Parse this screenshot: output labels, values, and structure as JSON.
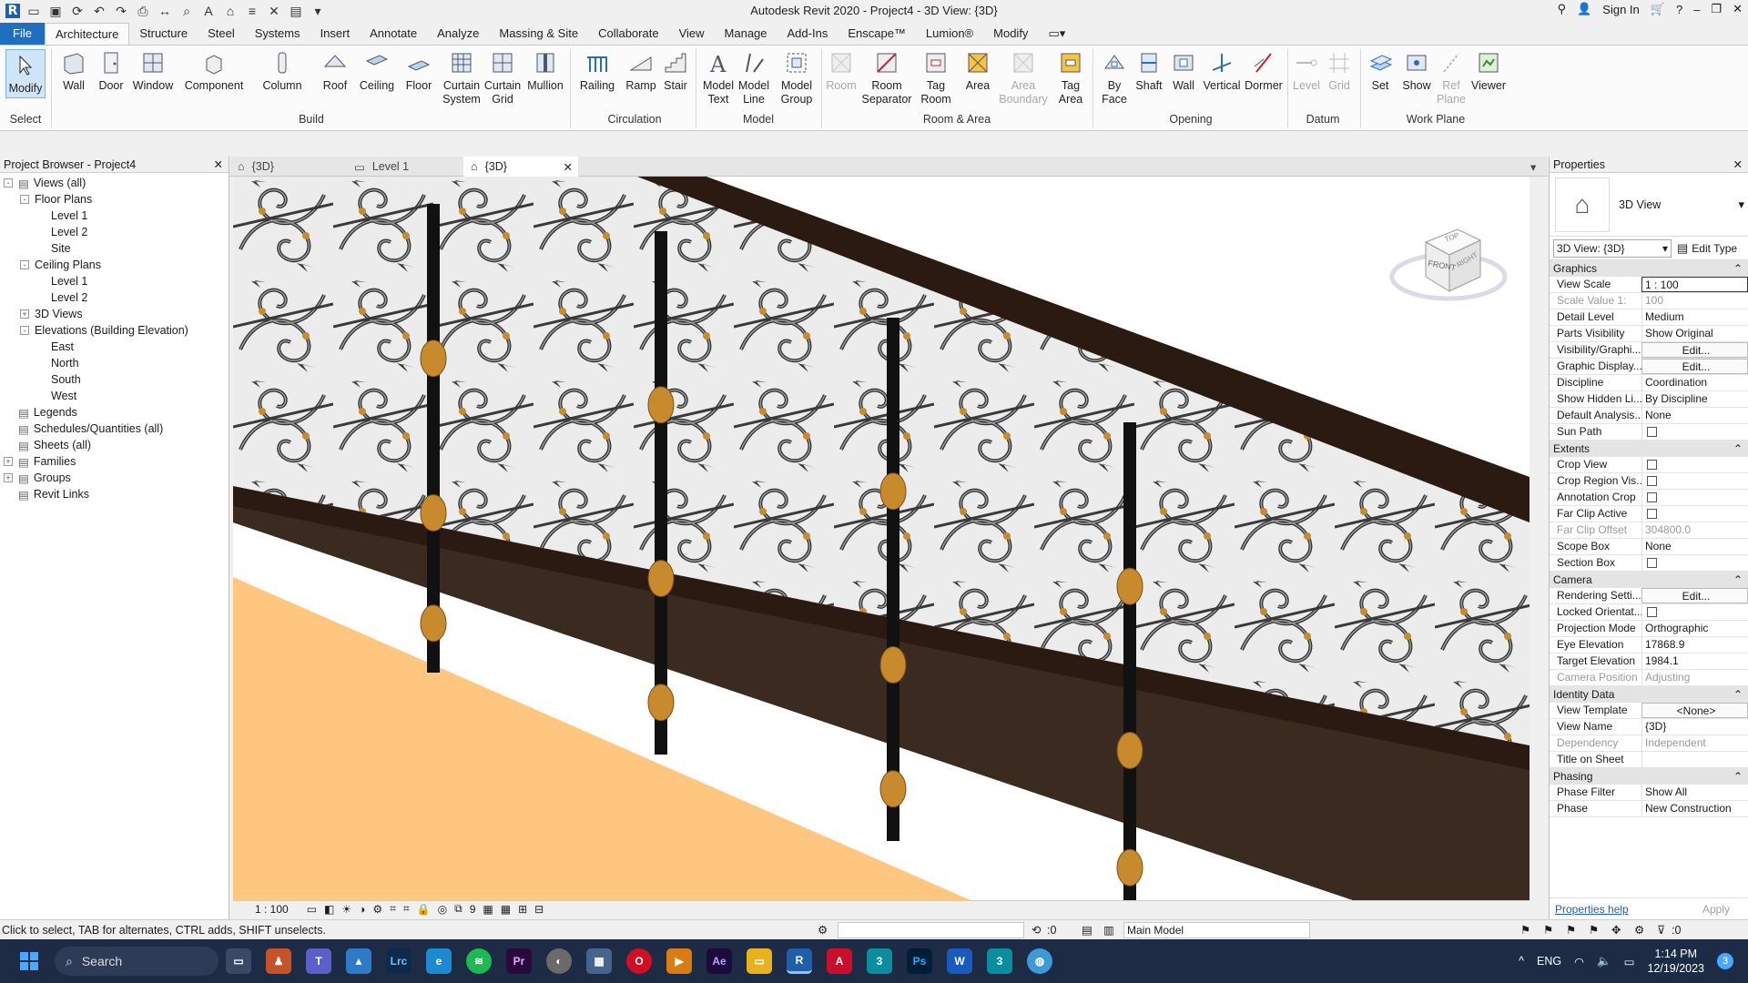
{
  "titlebar": {
    "title": "Autodesk Revit 2020 - Project4 - 3D View: {3D}",
    "sign_in": "Sign In"
  },
  "ribbon_tabs": [
    "File",
    "Architecture",
    "Structure",
    "Steel",
    "Systems",
    "Insert",
    "Annotate",
    "Analyze",
    "Massing & Site",
    "Collaborate",
    "View",
    "Manage",
    "Add-Ins",
    "Enscape™",
    "Lumion®",
    "Modify"
  ],
  "ribbon": {
    "select_label": "Select",
    "modify": "Modify",
    "build": {
      "label": "Build",
      "tools": [
        "Wall",
        "Door",
        "Window",
        "Component",
        "Column",
        "Roof",
        "Ceiling",
        "Floor",
        "Curtain System",
        "Curtain Grid",
        "Mullion"
      ]
    },
    "circulation": {
      "label": "Circulation",
      "tools": [
        "Railing",
        "Ramp",
        "Stair"
      ]
    },
    "model": {
      "label": "Model",
      "tools": [
        "Model Text",
        "Model Line",
        "Model Group"
      ]
    },
    "room_area": {
      "label": "Room & Area",
      "tools": [
        "Room",
        "Room Separator",
        "Tag Room",
        "Area",
        "Area Boundary",
        "Tag Area"
      ]
    },
    "opening": {
      "label": "Opening",
      "tools": [
        "By Face",
        "Shaft",
        "Wall",
        "Vertical",
        "Dormer"
      ]
    },
    "datum": {
      "label": "Datum",
      "tools": [
        "Level",
        "Grid"
      ]
    },
    "work_plane": {
      "label": "Work Plane",
      "tools": [
        "Set",
        "Show",
        "Ref Plane",
        "Viewer"
      ]
    }
  },
  "browser": {
    "title": "Project Browser - Project4",
    "tree": [
      {
        "label": "Views (all)",
        "level": 0,
        "toggle": "-"
      },
      {
        "label": "Floor Plans",
        "level": 1,
        "toggle": "-"
      },
      {
        "label": "Level 1",
        "level": 2,
        "toggle": ""
      },
      {
        "label": "Level 2",
        "level": 2,
        "toggle": ""
      },
      {
        "label": "Site",
        "level": 2,
        "toggle": ""
      },
      {
        "label": "Ceiling Plans",
        "level": 1,
        "toggle": "-"
      },
      {
        "label": "Level 1",
        "level": 2,
        "toggle": ""
      },
      {
        "label": "Level 2",
        "level": 2,
        "toggle": ""
      },
      {
        "label": "3D Views",
        "level": 1,
        "toggle": "+"
      },
      {
        "label": "Elevations (Building Elevation)",
        "level": 1,
        "toggle": "-"
      },
      {
        "label": "East",
        "level": 2,
        "toggle": ""
      },
      {
        "label": "North",
        "level": 2,
        "toggle": ""
      },
      {
        "label": "South",
        "level": 2,
        "toggle": ""
      },
      {
        "label": "West",
        "level": 2,
        "toggle": ""
      },
      {
        "label": "Legends",
        "level": 0,
        "toggle": ""
      },
      {
        "label": "Schedules/Quantities (all)",
        "level": 0,
        "toggle": ""
      },
      {
        "label": "Sheets (all)",
        "level": 0,
        "toggle": ""
      },
      {
        "label": "Families",
        "level": 0,
        "toggle": "+"
      },
      {
        "label": "Groups",
        "level": 0,
        "toggle": "+"
      },
      {
        "label": "Revit Links",
        "level": 0,
        "toggle": ""
      }
    ]
  },
  "view_tabs": [
    "{3D}",
    "Level 1",
    "{3D}"
  ],
  "view_control_bar": {
    "scale": "1 : 100",
    "extra": "9"
  },
  "viewcube": {
    "top": "TOP",
    "front": "FRONT",
    "right": "RIGHT"
  },
  "properties": {
    "title": "Properties",
    "type_name": "3D View",
    "selector": "3D View: {3D}",
    "edit_type": "Edit Type",
    "groups": [
      {
        "name": "Graphics",
        "rows": [
          {
            "k": "View Scale",
            "v": "1 : 100",
            "style": "box"
          },
          {
            "k": "Scale Value    1:",
            "v": "100",
            "style": "grey"
          },
          {
            "k": "Detail Level",
            "v": "Medium"
          },
          {
            "k": "Parts Visibility",
            "v": "Show Original"
          },
          {
            "k": "Visibility/Graphi...",
            "v": "Edit...",
            "style": "btn"
          },
          {
            "k": "Graphic Display...",
            "v": "Edit...",
            "style": "btn"
          },
          {
            "k": "Discipline",
            "v": "Coordination"
          },
          {
            "k": "Show Hidden Li...",
            "v": "By Discipline"
          },
          {
            "k": "Default Analysis...",
            "v": "None"
          },
          {
            "k": "Sun Path",
            "v": "",
            "style": "check"
          }
        ]
      },
      {
        "name": "Extents",
        "rows": [
          {
            "k": "Crop View",
            "v": "",
            "style": "check"
          },
          {
            "k": "Crop Region Vis...",
            "v": "",
            "style": "check"
          },
          {
            "k": "Annotation Crop",
            "v": "",
            "style": "check"
          },
          {
            "k": "Far Clip Active",
            "v": "",
            "style": "check"
          },
          {
            "k": "Far Clip Offset",
            "v": "304800.0",
            "style": "grey"
          },
          {
            "k": "Scope Box",
            "v": "None"
          },
          {
            "k": "Section Box",
            "v": "",
            "style": "check"
          }
        ]
      },
      {
        "name": "Camera",
        "rows": [
          {
            "k": "Rendering Setti...",
            "v": "Edit...",
            "style": "btn"
          },
          {
            "k": "Locked Orientat...",
            "v": "",
            "style": "check"
          },
          {
            "k": "Projection Mode",
            "v": "Orthographic"
          },
          {
            "k": "Eye Elevation",
            "v": "17868.9"
          },
          {
            "k": "Target Elevation",
            "v": "1984.1"
          },
          {
            "k": "Camera Position",
            "v": "Adjusting",
            "style": "grey"
          }
        ]
      },
      {
        "name": "Identity Data",
        "rows": [
          {
            "k": "View Template",
            "v": "<None>",
            "style": "btn"
          },
          {
            "k": "View Name",
            "v": "{3D}"
          },
          {
            "k": "Dependency",
            "v": "Independent",
            "style": "grey"
          },
          {
            "k": "Title on Sheet",
            "v": ""
          }
        ]
      },
      {
        "name": "Phasing",
        "rows": [
          {
            "k": "Phase Filter",
            "v": "Show All"
          },
          {
            "k": "Phase",
            "v": "New Construction"
          }
        ]
      }
    ],
    "help": "Properties help",
    "apply": "Apply"
  },
  "status": {
    "hint": "Click to select, TAB for alternates, CTRL adds, SHIFT unselects.",
    "count": ":0",
    "model": "Main Model",
    "filter_count": ":0"
  },
  "taskbar": {
    "search": "Search",
    "lang": "ENG",
    "time": "1:14 PM",
    "date": "12/19/2023",
    "badge": "3"
  },
  "colors": {
    "file_tab": "#1f6ec0",
    "taskbar": "#1d2b45",
    "floor": "#ffc680",
    "rail": "#2a1a12"
  }
}
